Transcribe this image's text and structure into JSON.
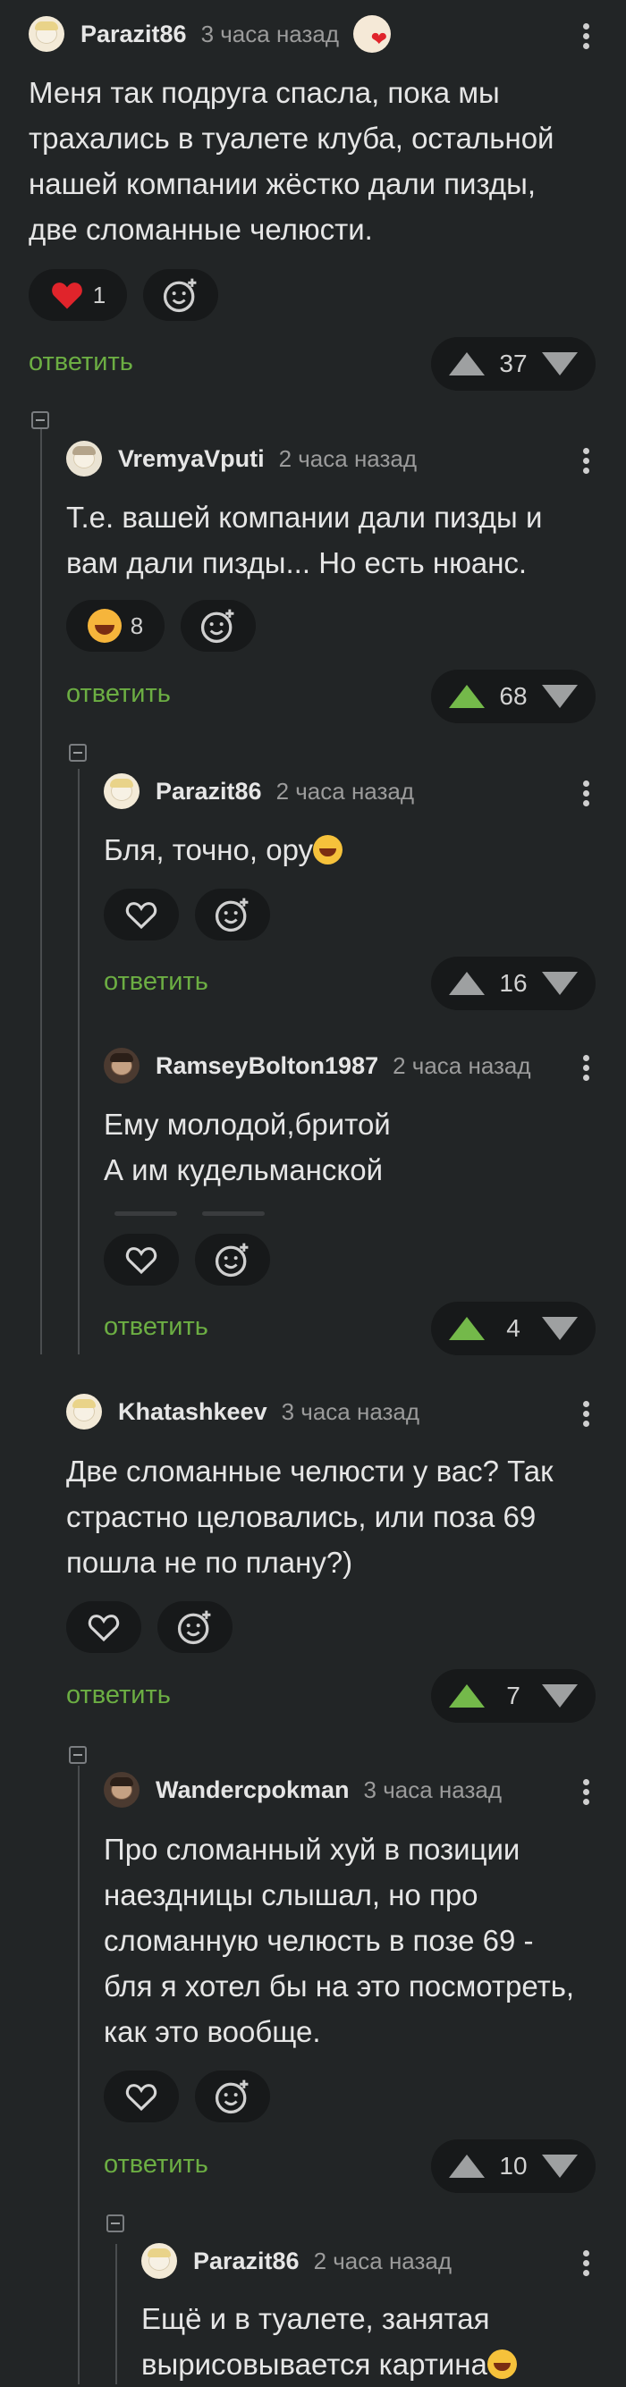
{
  "comments": [
    {
      "username": "Parazit86",
      "time": "3 часа назад",
      "text": "Меня так подруга спасла, пока мы\nтрахались в туалете клуба, остальной\nнашей компании жёстко дали пизды,\nдве сломанные челюсти.",
      "reaction_count": "1",
      "reply": "ответить",
      "score": "37"
    },
    {
      "username": "VremyaVputi",
      "time": "2 часа назад",
      "text": "Т.е. вашей компании дали пизды и\nвам дали пизды... Но есть нюанс.",
      "reaction_count": "8",
      "reply": "ответить",
      "score": "68"
    },
    {
      "username": "Parazit86",
      "time": "2 часа назад",
      "text": "Бля, точно, ору",
      "reply": "ответить",
      "score": "16"
    },
    {
      "username": "RamseyBolton1987",
      "time": "2 часа назад",
      "text": "Ему молодой,бритой\nА им кудельманской",
      "reply": "ответить",
      "score": "4"
    },
    {
      "username": "Khatashkeev",
      "time": "3 часа назад",
      "text": "Две сломанные челюсти у вас? Так\nстрастно целовались, или поза 69\nпошла не по плану?)",
      "reply": "ответить",
      "score": "7"
    },
    {
      "username": "Wandercpokman",
      "time": "3 часа назад",
      "text": "Про сломанный хуй в позиции\nнаездницы слышал, но про\nсломанную челюсть в позе 69 -\nбля я хотел бы на это посмотреть,\nкак это вообще.",
      "reply": "ответить",
      "score": "10"
    },
    {
      "username": "Parazit86",
      "time": "2 часа назад",
      "text": "Ещё и в туалете, занятая\nвырисовывается картина"
    }
  ],
  "colors": {
    "background": "#222526",
    "reply_green": "#6cae43",
    "vote_active": "#74b94a",
    "heart_red": "#e0242b"
  }
}
